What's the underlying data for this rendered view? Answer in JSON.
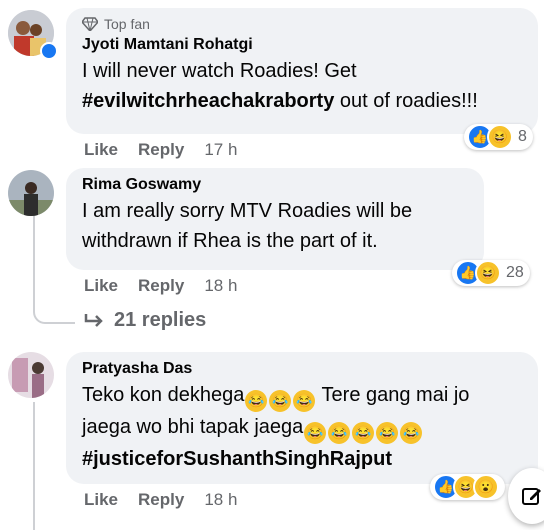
{
  "comments": [
    {
      "badge": "Top fan",
      "author": "Jyoti Mamtani Rohatgi",
      "line1": "I will never watch Roadies! Get",
      "line2_tag": "#evilwitchrheachakraborty",
      "line2_rest": " out of roadies!!!",
      "like": "Like",
      "reply": "Reply",
      "time": "17 h",
      "reaction_count": "8",
      "reactions": [
        "like-icon",
        "haha-icon"
      ]
    },
    {
      "author": "Rima Goswamy",
      "line1": "I am really sorry MTV Roadies will be",
      "line2": "withdrawn if Rhea is the part of it.",
      "like": "Like",
      "reply": "Reply",
      "time": "18 h",
      "reaction_count": "28",
      "reactions": [
        "like-icon",
        "haha-icon"
      ]
    },
    {
      "author": "Pratyasha Das",
      "line1": "Teko kon dekhega",
      "line1_b": " Tere gang mai jo",
      "line2": "jaega wo bhi tapak jaega",
      "line3_tag": "#justiceforSushanthSinghRajput",
      "like": "Like",
      "reply": "Reply",
      "time": "18 h",
      "reactions": [
        "like-icon",
        "haha-icon",
        "wow-icon"
      ]
    }
  ],
  "replies_link": "21 replies",
  "colors": {
    "bubble": "#f0f2f5",
    "like_blue": "#1877f2",
    "emoji_yellow": "#f7c22a",
    "meta_gray": "#65676b"
  }
}
